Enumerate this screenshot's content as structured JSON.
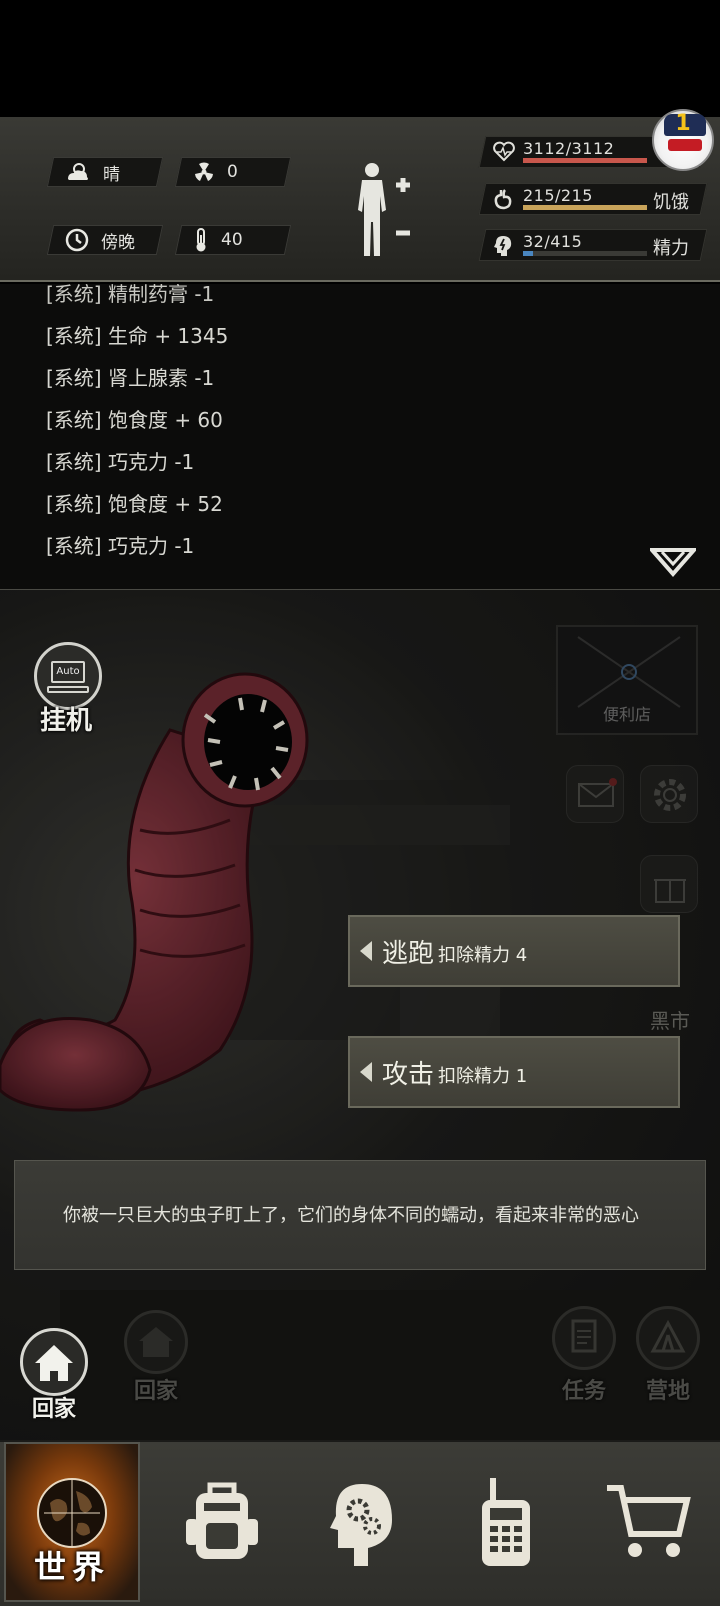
{
  "status": {
    "weather": {
      "icon": "cloud-sun-icon",
      "label": "晴"
    },
    "radiation": {
      "icon": "radiation-icon",
      "value": "0"
    },
    "time": {
      "icon": "clock-icon",
      "label": "傍晚"
    },
    "temperature": {
      "icon": "thermometer-icon",
      "value": "40"
    },
    "health": {
      "icon": "heart-icon",
      "text": "3112/3112",
      "fraction": 1.0,
      "color": "#c8574c"
    },
    "hunger": {
      "icon": "stomach-icon",
      "text": "215/215",
      "label": "饥饿",
      "fraction": 1.0,
      "color": "#c9a45a"
    },
    "energy": {
      "icon": "brain-bolt-icon",
      "text": "32/415",
      "label": "精力",
      "fraction": 0.077,
      "color": "#4a86c0"
    },
    "notification_badge": {
      "count": "1",
      "icon": "player-avatar-icon"
    }
  },
  "log": {
    "lines": [
      "[系统] 精制药膏 -1",
      "[系统] 生命 + 1345",
      "[系统] 肾上腺素 -1",
      "[系统] 饱食度 + 60",
      "[系统] 巧克力 -1",
      "[系统] 饱食度 + 52",
      "[系统] 巧克力 -1"
    ]
  },
  "scene": {
    "auto": {
      "screen_text": "Auto",
      "label": "挂机"
    },
    "store_label": "便利店",
    "black_market_label": "黑市",
    "actions": [
      {
        "name": "逃跑",
        "cost": "扣除精力 4"
      },
      {
        "name": "攻击",
        "cost": "扣除精力 1"
      }
    ],
    "message": "你被一只巨大的虫子盯上了，它们的身体不同的蠕动，看起来非常的恶心",
    "nav": {
      "home_active": "回家",
      "home_dim": "回家",
      "task": "任务",
      "camp": "营地"
    }
  },
  "bottom_nav": {
    "world_label": "世界",
    "tabs": [
      "world-globe-icon",
      "backpack-icon",
      "skills-head-icon",
      "radio-icon",
      "shopping-cart-icon"
    ]
  }
}
